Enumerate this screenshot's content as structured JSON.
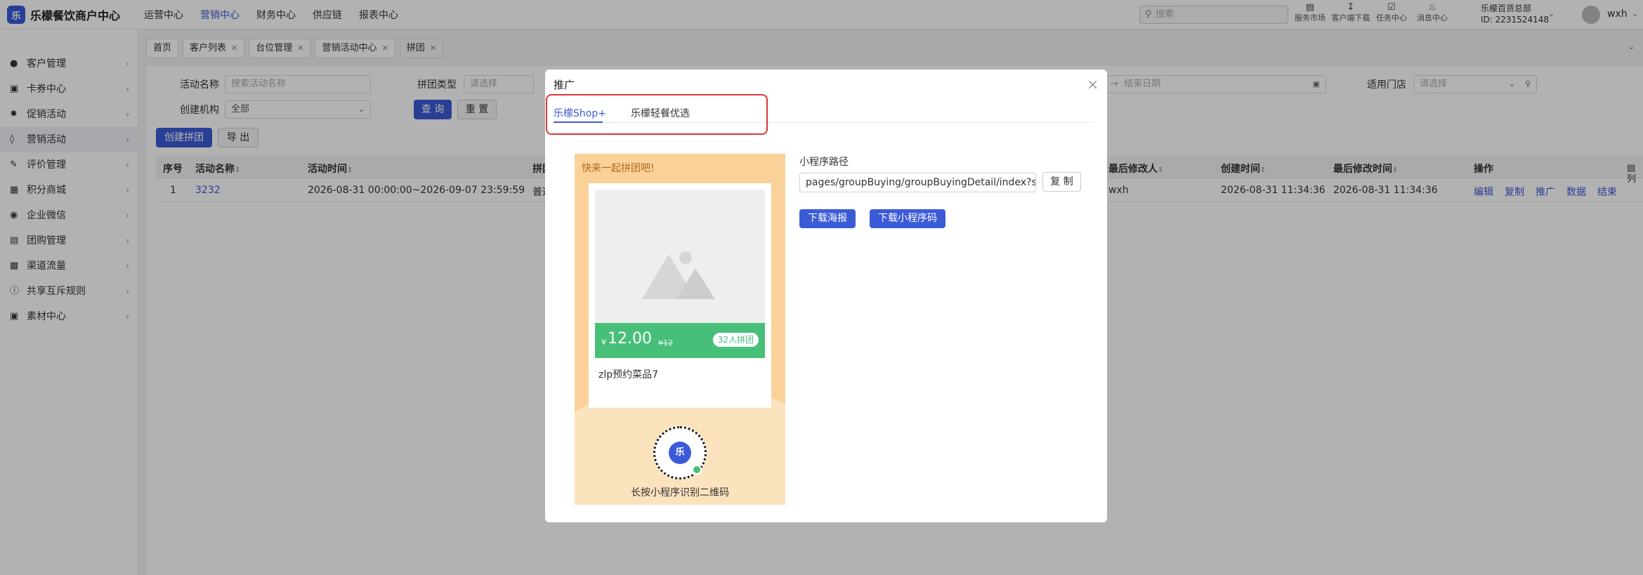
{
  "app": {
    "logo_char": "乐",
    "title": "乐檬餐饮商户中心"
  },
  "topnav": [
    "运营中心",
    "营销中心",
    "财务中心",
    "供应链",
    "报表中心"
  ],
  "search": {
    "placeholder": "搜索",
    "icon": "search-icon"
  },
  "tools": [
    {
      "label": "服务市场",
      "icon": "store-icon"
    },
    {
      "label": "客户端下载",
      "icon": "download-icon"
    },
    {
      "label": "任务中心",
      "icon": "task-icon"
    },
    {
      "label": "消息中心",
      "icon": "bell-icon"
    }
  ],
  "org": {
    "name": "乐檬百货总部",
    "id": "ID: 2231524148"
  },
  "user": {
    "name": "wxh"
  },
  "sidebar": [
    {
      "label": "客户管理",
      "icon": "user-icon"
    },
    {
      "label": "卡券中心",
      "icon": "ticket-icon"
    },
    {
      "label": "促销活动",
      "icon": "promo-icon"
    },
    {
      "label": "营销活动",
      "icon": "tag-icon"
    },
    {
      "label": "评价管理",
      "icon": "review-icon"
    },
    {
      "label": "积分商城",
      "icon": "gift-icon"
    },
    {
      "label": "企业微信",
      "icon": "chat-icon"
    },
    {
      "label": "团购管理",
      "icon": "group-icon"
    },
    {
      "label": "渠道流量",
      "icon": "shop-icon"
    },
    {
      "label": "共享互斥规则",
      "icon": "info-icon"
    },
    {
      "label": "素材中心",
      "icon": "image-icon"
    }
  ],
  "tabs": [
    {
      "label": "首页",
      "closable": false
    },
    {
      "label": "客户列表",
      "closable": true
    },
    {
      "label": "台位管理",
      "closable": true
    },
    {
      "label": "营销活动中心",
      "closable": true
    },
    {
      "label": "拼团",
      "closable": true
    }
  ],
  "filters": {
    "name_label": "活动名称",
    "name_placeholder": "搜索活动名称",
    "type_label": "拼团类型",
    "type_placeholder": "请选择",
    "end_placeholder": "结束日期",
    "date_arrow": "→",
    "store_label": "适用门店",
    "store_placeholder": "请选择",
    "org_label": "创建机构",
    "org_value": "全部",
    "query_btn": "查 询",
    "reset_btn": "重 置"
  },
  "actions": {
    "create": "创建拼团",
    "export": "导 出"
  },
  "table": {
    "headers": [
      "序号",
      "活动名称",
      "活动时间",
      "拼团",
      "最后修改人",
      "创建时间",
      "最后修改时间",
      "操作"
    ],
    "row": {
      "index": "1",
      "name": "3232",
      "time": "2026-08-31 00:00:00~2026-09-07 23:59:59",
      "type": "普通",
      "modifier": "wxh",
      "created": "2026-08-31 11:34:36",
      "modified": "2026-08-31 11:34:36",
      "ops": [
        "编辑",
        "复制",
        "推广",
        "数据",
        "结束"
      ]
    },
    "col_toggle": "列"
  },
  "modal": {
    "title": "推广",
    "close": "×",
    "tabs": [
      "乐檬Shop+",
      "乐檬轻餐优选"
    ],
    "poster": {
      "header": "快来一起拼团吧!",
      "currency": "¥",
      "price": "12.00",
      "orig_price": "¥12",
      "badge": "32人拼团",
      "product_name": "zlp预约菜品7",
      "qr_caption": "长按小程序识别二维码"
    },
    "path_label": "小程序路径",
    "path_value": "pages/groupBuying/groupBuyingDetail/index?sce",
    "copy_btn": "复 制",
    "download_poster": "下载海报",
    "download_qr": "下载小程序码"
  },
  "colors": {
    "primary": "#3b5bd6",
    "green": "#47bf79",
    "poster_bg": "#f9d199",
    "highlight": "#e0343a"
  }
}
